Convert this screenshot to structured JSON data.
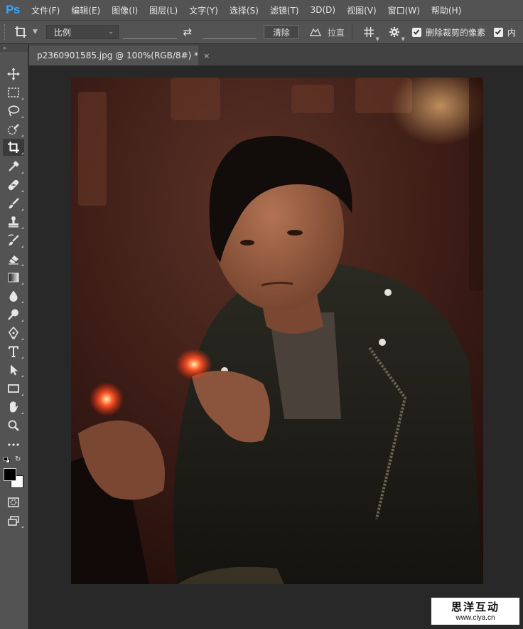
{
  "app": {
    "logo": "Ps"
  },
  "menu": [
    "文件(F)",
    "编辑(E)",
    "图像(I)",
    "图层(L)",
    "文字(Y)",
    "选择(S)",
    "滤镜(T)",
    "3D(D)",
    "视图(V)",
    "窗口(W)",
    "帮助(H)"
  ],
  "options": {
    "ratio_value": "比例",
    "clear_label": "清除",
    "straighten_label": "拉直",
    "delete_cropped_label": "删除裁剪的像素",
    "content_aware_label": "内"
  },
  "document": {
    "tab_title": "p2360901585.jpg @ 100%(RGB/8#) *",
    "close_glyph": "×"
  },
  "toolbar": {
    "tools": [
      "move-tool",
      "marquee-tool",
      "lasso-tool",
      "quick-selection-tool",
      "crop-tool",
      "eyedropper-tool",
      "healing-brush-tool",
      "brush-tool",
      "clone-stamp-tool",
      "history-brush-tool",
      "eraser-tool",
      "gradient-tool",
      "blur-tool",
      "dodge-tool",
      "pen-tool",
      "type-tool",
      "path-selection-tool",
      "rectangle-tool",
      "hand-tool",
      "zoom-tool",
      "more-tools"
    ],
    "active_tool": "crop-tool",
    "foreground_color": "#000000",
    "background_color": "#ffffff"
  },
  "watermark": {
    "title": "思洋互动",
    "url": "www.ciya.cn"
  }
}
